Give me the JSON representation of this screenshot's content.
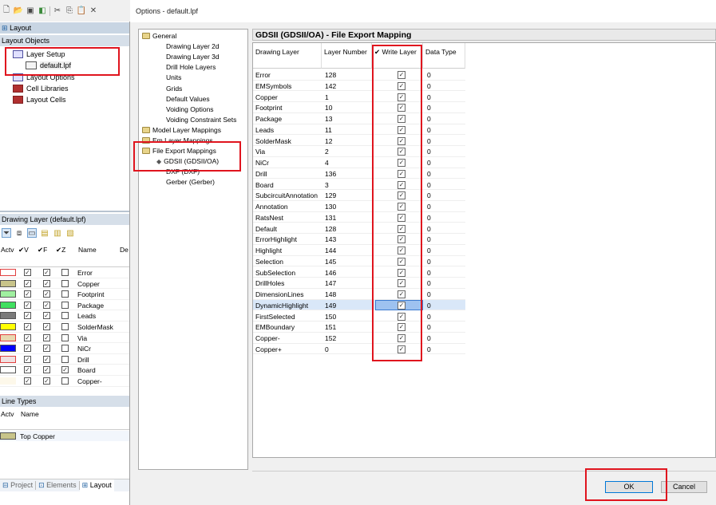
{
  "app": {
    "toolbar_icons": [
      "new-file-icon",
      "open-folder-icon",
      "save-icon",
      "export-icon",
      "cut-icon",
      "copy-icon",
      "paste-icon",
      "delete-icon"
    ],
    "layout_tab_title": "Layout",
    "layout_objects_header": "Layout Objects",
    "tree": [
      {
        "label": "Layer Setup",
        "icon": "layer-icon"
      },
      {
        "label": "default.lpf",
        "icon": "document-icon"
      },
      {
        "label": "Layout Options",
        "icon": "layer-icon"
      },
      {
        "label": "Cell Libraries",
        "icon": "library-icon"
      },
      {
        "label": "Layout Cells",
        "icon": "library-icon"
      }
    ],
    "drawing_layer_header": "Drawing Layer (default.lpf)",
    "drawing_layer_columns": [
      "Actv",
      "✔V",
      "✔F",
      "✔Z",
      "Name",
      "De"
    ],
    "drawing_layers": [
      {
        "name": "Error",
        "color": "#ffffff",
        "border": "#e04040",
        "v": true,
        "f": true,
        "z": false
      },
      {
        "name": "Copper",
        "color": "#c8c48a",
        "border": "#555555",
        "v": true,
        "f": true,
        "z": false
      },
      {
        "name": "Footprint",
        "color": "#a0f0a0",
        "border": "#555555",
        "v": true,
        "f": true,
        "z": false
      },
      {
        "name": "Package",
        "color": "#40e060",
        "border": "#555555",
        "v": true,
        "f": true,
        "z": false
      },
      {
        "name": "Leads",
        "color": "#7a7a7a",
        "border": "#555555",
        "v": true,
        "f": true,
        "z": false
      },
      {
        "name": "SolderMask",
        "color": "#ffff00",
        "border": "#555555",
        "v": true,
        "f": true,
        "z": false
      },
      {
        "name": "Via",
        "color": "#e8d8b0",
        "border": "#e04040",
        "v": true,
        "f": true,
        "z": false
      },
      {
        "name": "NiCr",
        "color": "#0000ff",
        "border": "#555555",
        "v": true,
        "f": true,
        "z": false
      },
      {
        "name": "Drill",
        "color": "#f0e0e0",
        "border": "#e04040",
        "v": true,
        "f": true,
        "z": false
      },
      {
        "name": "Board",
        "color": "#ffffff",
        "border": "#555555",
        "v": true,
        "f": true,
        "z": true
      },
      {
        "name": "Copper-",
        "color": "#fdf8ea",
        "border": "#fdf8ea",
        "v": true,
        "f": true,
        "z": false
      }
    ],
    "line_types_header": "Line Types",
    "line_types_columns": [
      "Actv",
      "Name"
    ],
    "line_types": [
      {
        "name": "Top Copper",
        "color": "#c8c48a"
      }
    ],
    "bottom_tabs": [
      "Project",
      "Elements",
      "Layout"
    ]
  },
  "dialog": {
    "title": "Options - default.lpf",
    "nav": [
      {
        "label": "General",
        "level": 0,
        "folder": true
      },
      {
        "label": "Drawing Layer 2d",
        "level": 1
      },
      {
        "label": "Drawing Layer 3d",
        "level": 1
      },
      {
        "label": "Drill Hole Layers",
        "level": 1
      },
      {
        "label": "Units",
        "level": 1
      },
      {
        "label": "Grids",
        "level": 1
      },
      {
        "label": "Default Values",
        "level": 1
      },
      {
        "label": "Voiding Options",
        "level": 1
      },
      {
        "label": "Voiding Constraint Sets",
        "level": 1
      },
      {
        "label": "Model Layer Mappings",
        "level": 0,
        "folder": true
      },
      {
        "label": "Em Layer Mappings",
        "level": 0,
        "folder": true
      },
      {
        "label": "File Export Mappings",
        "level": 0,
        "folder": true
      },
      {
        "label": "GDSII (GDSII/OA)",
        "level": 1,
        "selected": true
      },
      {
        "label": "DXF (DXF)",
        "level": 1
      },
      {
        "label": "Gerber (Gerber)",
        "level": 1
      }
    ],
    "panel_title": "GDSII (GDSII/OA) - File Export Mapping",
    "columns": [
      "Drawing Layer",
      "Layer Number",
      "✔ Write Layer",
      "Data Type"
    ],
    "rows": [
      {
        "layer": "Error",
        "number": "128",
        "write": true,
        "type": "0"
      },
      {
        "layer": "EMSymbols",
        "number": "142",
        "write": true,
        "type": "0"
      },
      {
        "layer": "Copper",
        "number": "1",
        "write": true,
        "type": "0"
      },
      {
        "layer": "Footprint",
        "number": "10",
        "write": true,
        "type": "0"
      },
      {
        "layer": "Package",
        "number": "13",
        "write": true,
        "type": "0"
      },
      {
        "layer": "Leads",
        "number": "11",
        "write": true,
        "type": "0"
      },
      {
        "layer": "SolderMask",
        "number": "12",
        "write": true,
        "type": "0"
      },
      {
        "layer": "Via",
        "number": "2",
        "write": true,
        "type": "0"
      },
      {
        "layer": "NiCr",
        "number": "4",
        "write": true,
        "type": "0"
      },
      {
        "layer": "Drill",
        "number": "136",
        "write": true,
        "type": "0"
      },
      {
        "layer": "Board",
        "number": "3",
        "write": true,
        "type": "0"
      },
      {
        "layer": "SubcircuitAnnotation",
        "number": "129",
        "write": true,
        "type": "0"
      },
      {
        "layer": "Annotation",
        "number": "130",
        "write": true,
        "type": "0"
      },
      {
        "layer": "RatsNest",
        "number": "131",
        "write": true,
        "type": "0"
      },
      {
        "layer": "Default",
        "number": "128",
        "write": true,
        "type": "0"
      },
      {
        "layer": "ErrorHighlight",
        "number": "143",
        "write": true,
        "type": "0"
      },
      {
        "layer": "Highlight",
        "number": "144",
        "write": true,
        "type": "0"
      },
      {
        "layer": "Selection",
        "number": "145",
        "write": true,
        "type": "0"
      },
      {
        "layer": "SubSelection",
        "number": "146",
        "write": true,
        "type": "0"
      },
      {
        "layer": "DrillHoles",
        "number": "147",
        "write": true,
        "type": "0"
      },
      {
        "layer": "DimensionLines",
        "number": "148",
        "write": true,
        "type": "0"
      },
      {
        "layer": "DynamicHighlight",
        "number": "149",
        "write": true,
        "type": "0",
        "selected": true
      },
      {
        "layer": "FirstSelected",
        "number": "150",
        "write": true,
        "type": "0"
      },
      {
        "layer": "EMBoundary",
        "number": "151",
        "write": true,
        "type": "0"
      },
      {
        "layer": "Copper-",
        "number": "152",
        "write": true,
        "type": "0"
      },
      {
        "layer": "Copper+",
        "number": "0",
        "write": true,
        "type": "0"
      }
    ],
    "ok_label": "OK",
    "cancel_label": "Cancel"
  },
  "annotation_color": "#e0141e"
}
